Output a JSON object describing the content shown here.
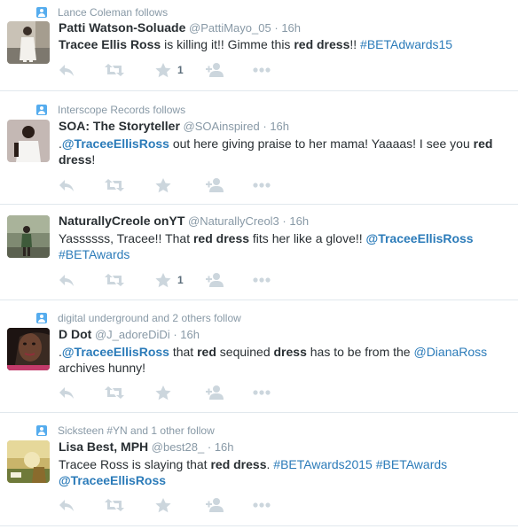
{
  "colors": {
    "icon": "#ccd6dd",
    "link": "#2b7bb9",
    "context_icon": "#55acee",
    "muted": "#8899a6"
  },
  "tweets": [
    {
      "context": "Lance Coleman follows",
      "name": "Patti Watson-Soluade",
      "handle": "@PattiMayo_05",
      "sep": "·",
      "time": "16h",
      "line1": [
        "Tracee Ellis Ross",
        " is killing it!! Gimme this ",
        "red dress",
        "!! ",
        "#BETAdwards15"
      ],
      "favorite_count": "1"
    },
    {
      "context": "Interscope Records follows",
      "name": "SOA: The Storyteller",
      "handle": "@SOAinspired",
      "sep": "·",
      "time": "16h",
      "line1": [
        ".",
        "@TraceeEllisRoss",
        " out here giving praise to her mama! Yaaaas! I see you ",
        "red"
      ],
      "line2": [
        "dress",
        "!"
      ],
      "favorite_count": ""
    },
    {
      "context": "",
      "name": "NaturallyCreole onYT",
      "handle": "@NaturallyCreol3",
      "sep": "·",
      "time": "16h",
      "line1": [
        "Yassssss, Tracee!! That ",
        "red dress",
        " fits her like a glove!! ",
        "@TraceeEllisRoss"
      ],
      "line2": [
        "#BETAwards"
      ],
      "favorite_count": "1"
    },
    {
      "context": "digital underground and 2 others follow",
      "name": "D Dot",
      "handle": "@J_adoreDiDi",
      "sep": "·",
      "time": "16h",
      "line1": [
        ".",
        "@TraceeEllisRoss",
        " that ",
        "red",
        " sequined ",
        "dress",
        " has to be from the ",
        "@DianaRoss"
      ],
      "line2": [
        "archives hunny!"
      ],
      "favorite_count": ""
    },
    {
      "context": "Sicksteen #YN and 1 other follow",
      "name": "Lisa Best, MPH",
      "handle": "@best28_",
      "sep": "·",
      "time": "16h",
      "line1": [
        "Tracee Ross is slaying that ",
        "red dress",
        ". ",
        "#BETAwards2015",
        " ",
        "#BETAwards"
      ],
      "line2": [
        "@TraceeEllisRoss"
      ],
      "favorite_count": ""
    }
  ]
}
